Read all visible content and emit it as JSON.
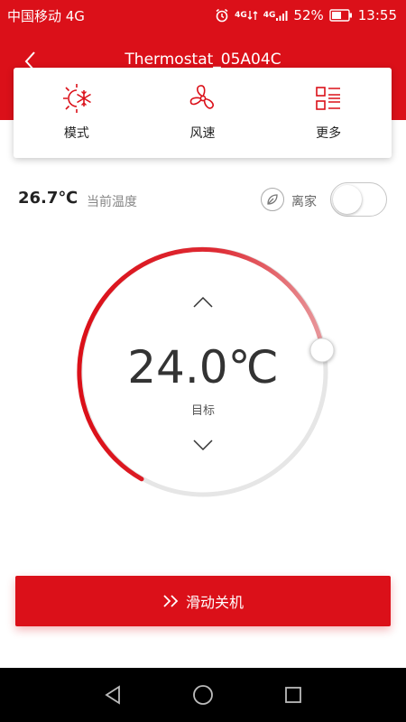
{
  "status_bar": {
    "carrier": "中国移动 4G",
    "net1": "4G",
    "net2": "4G",
    "battery": "52%",
    "time": "13:55"
  },
  "header": {
    "title": "Thermostat_05A04C"
  },
  "menu": [
    {
      "label": "模式",
      "icon": "mode-sun-snowflake-icon"
    },
    {
      "label": "风速",
      "icon": "fan-icon"
    },
    {
      "label": "更多",
      "icon": "more-list-icon"
    }
  ],
  "current": {
    "temperature": "26.7℃",
    "label": "当前温度"
  },
  "away": {
    "label": "离家",
    "enabled": false
  },
  "target": {
    "temperature": "24.0℃",
    "label": "目标"
  },
  "power_button": {
    "label": "滑动关机",
    "icon": "double-chevron-right-icon"
  },
  "colors": {
    "accent": "#db1019",
    "track": "#e6e6e6"
  }
}
